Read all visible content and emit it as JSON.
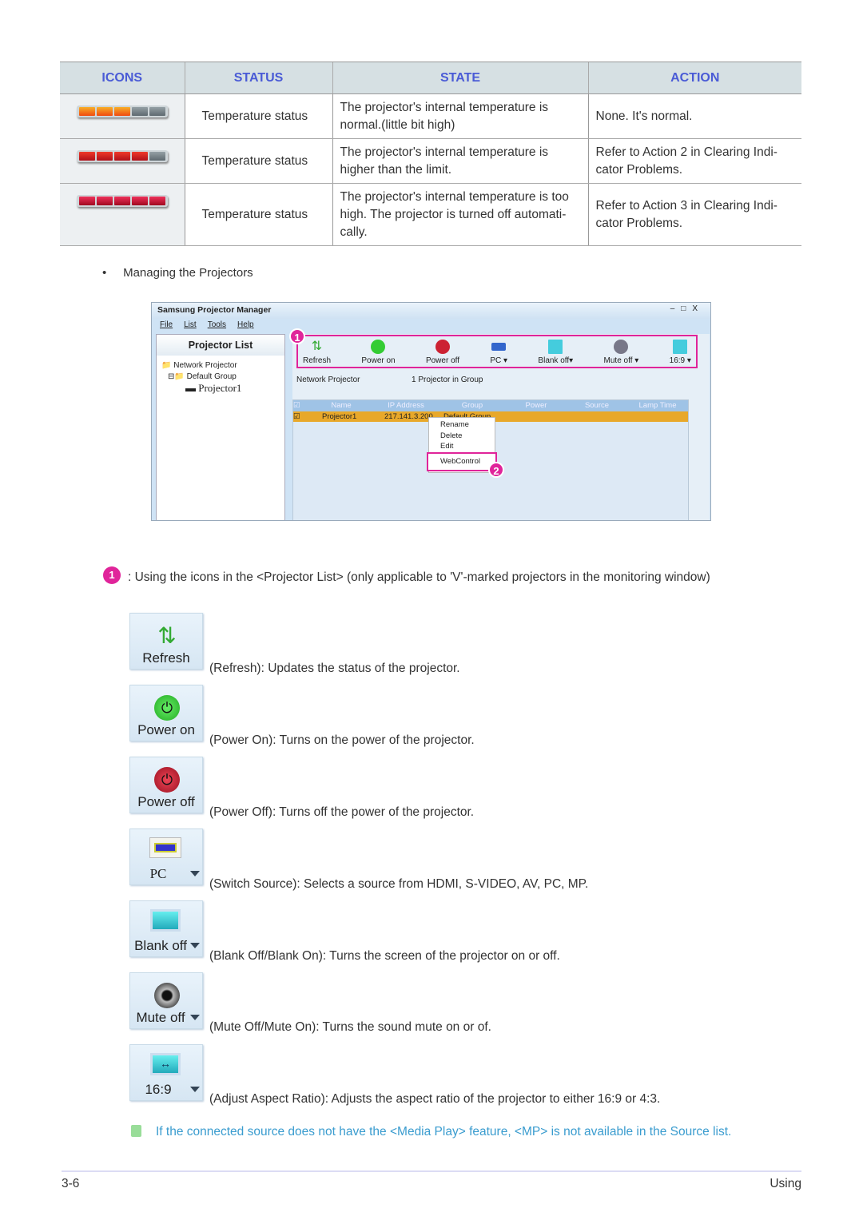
{
  "table": {
    "headers": [
      "ICONS",
      "STATUS",
      "STATE",
      "ACTION"
    ],
    "rows": [
      {
        "icon": "temperature-bar-3-of-5",
        "status": "Temperature status",
        "state": "The projector's internal temperature is normal.(little bit high)",
        "action": "None. It's normal."
      },
      {
        "icon": "temperature-bar-4-of-5",
        "status": "Temperature status",
        "state": "The projector's internal temperature is higher than the limit.",
        "action": "Refer to Action 2 in Clearing Indi-cator Problems."
      },
      {
        "icon": "temperature-bar-5-of-5",
        "status": "Temperature status",
        "state": "The projector's internal temperature is too high. The projector is turned off automati-cally.",
        "action": "Refer to Action 3 in Clearing Indi-cator Problems."
      }
    ]
  },
  "bullet": "Managing the Projectors",
  "app": {
    "title": "Samsung Projector Manager",
    "menu": [
      "File",
      "List",
      "Tools",
      "Help"
    ],
    "sidebar_title": "Projector List",
    "tree": [
      "Network Projector",
      "Default Group",
      "Projector1"
    ],
    "toolbar": [
      "Refresh",
      "Power on",
      "Power off",
      "PC",
      "Blank off",
      "Mute off",
      "16:9"
    ],
    "info_left": "Network Projector",
    "info_right": "1 Projector in Group",
    "columns": [
      "Name",
      "IP Address",
      "Group",
      "Power",
      "Source",
      "Lamp Time"
    ],
    "row": {
      "name": "Projector1",
      "ip": "217.141.3.200",
      "group": "Default Group"
    },
    "context_menu": [
      "Rename",
      "Delete",
      "Edit",
      "WebControl"
    ],
    "badges": [
      "1",
      "2"
    ],
    "accent": "#e0249a"
  },
  "note1": ": Using the icons in the <Projector List> (only applicable to 'V'-marked projectors in the monitoring window)",
  "buttons": [
    {
      "label": "Refresh",
      "desc": "(Refresh): Updates the status of the projector."
    },
    {
      "label": "Power on",
      "desc": "(Power On): Turns on the power of the projector."
    },
    {
      "label": "Power off",
      "desc": "(Power Off): Turns off the power of the projector."
    },
    {
      "label": "PC",
      "desc": "(Switch Source): Selects a source from HDMI, S-VIDEO, AV, PC, MP."
    },
    {
      "label": "Blank off",
      "desc": "(Blank Off/Blank On): Turns the screen of the projector on or off."
    },
    {
      "label": "Mute off",
      "desc": "(Mute Off/Mute On): Turns the sound mute on or of."
    },
    {
      "label": "16:9",
      "desc": "(Adjust Aspect Ratio): Adjusts the aspect ratio of the projector to either 16:9 or 4:3."
    }
  ],
  "note2": "If the connected source does not have the <Media Play> feature, <MP> is not available in the Source list.",
  "footer": {
    "page": "3-6",
    "section": "Using"
  }
}
